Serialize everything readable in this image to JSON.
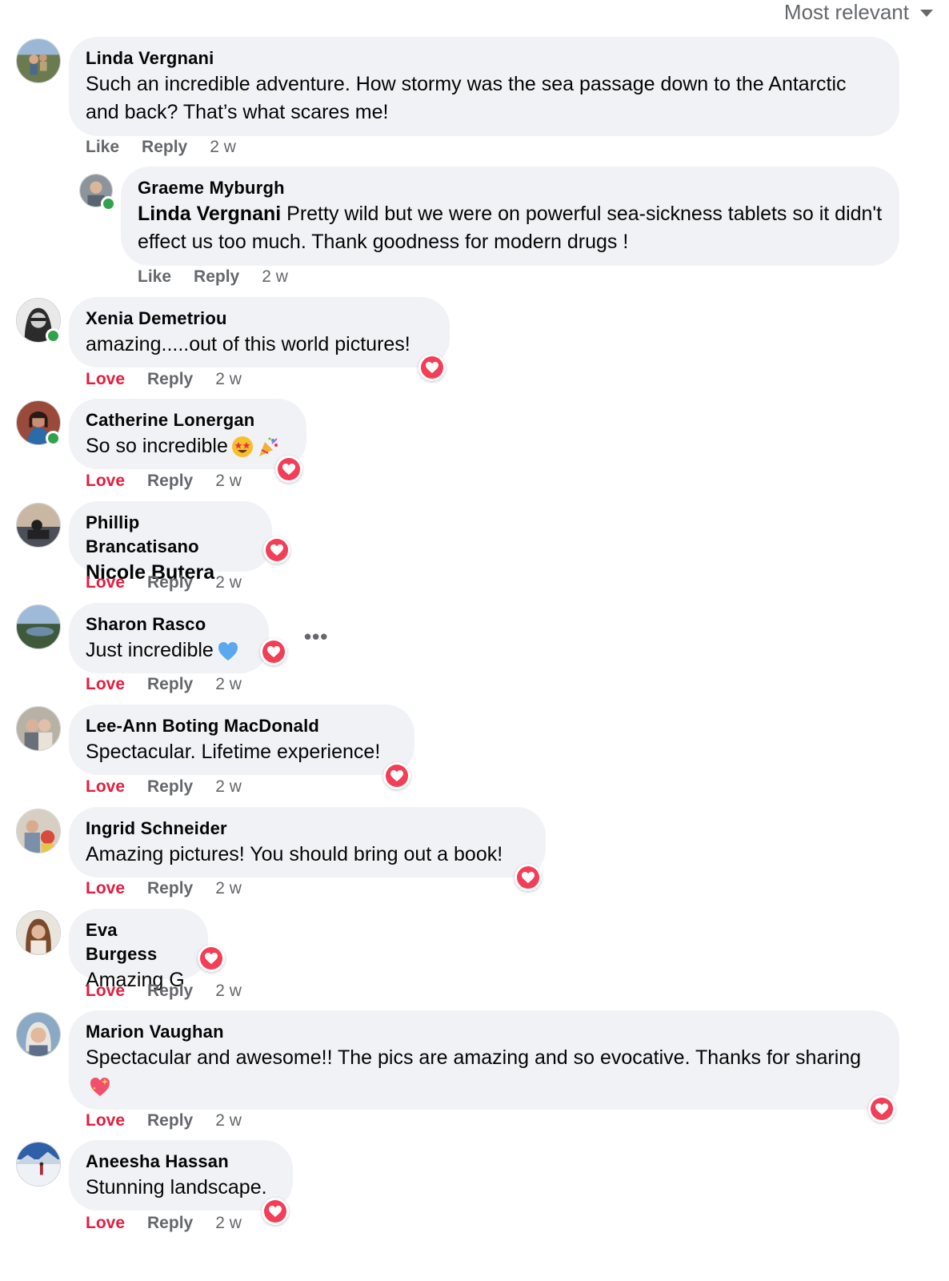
{
  "sort": {
    "label": "Most relevant",
    "icon": "caret-down-icon"
  },
  "actions": {
    "like": "Like",
    "love": "Love",
    "reply": "Reply"
  },
  "comments": [
    {
      "name": "Linda Vergnani",
      "text": "Such an incredible adventure. How stormy was the sea passage down to the Antarctic and back? That’s what scares me!",
      "time": "2 w",
      "reaction": "Like"
    },
    {
      "name": "Graeme Myburgh",
      "mention": "Linda Vergnani",
      "text": " Pretty wild but we were on powerful sea-sickness tablets so it didn't effect us too much. Thank goodness for modern drugs !",
      "time": "2 w",
      "reaction": "Like"
    },
    {
      "name": "Xenia Demetriou",
      "text": "amazing.....out of this world pictures!",
      "time": "2 w",
      "reaction": "Love"
    },
    {
      "name": "Catherine Lonergan",
      "text": "So so incredible",
      "time": "2 w",
      "reaction": "Love",
      "emojis": [
        "star-struck-emoji",
        "party-popper-emoji"
      ]
    },
    {
      "name": "Phillip Brancatisano",
      "mention": "Nicole Butera",
      "text": "",
      "time": "2 w",
      "reaction": "Love"
    },
    {
      "name": "Sharon Rasco",
      "text": "Just incredible",
      "time": "2 w",
      "reaction": "Love",
      "emojis": [
        "blue-heart-emoji"
      ]
    },
    {
      "name": "Lee-Ann Boting MacDonald",
      "text": "Spectacular. Lifetime experience!",
      "time": "2 w",
      "reaction": "Love"
    },
    {
      "name": "Ingrid Schneider",
      "text": "Amazing pictures! You should bring out a book!",
      "time": "2 w",
      "reaction": "Love"
    },
    {
      "name": "Eva Burgess",
      "text": "Amazing G",
      "time": "2 w",
      "reaction": "Love"
    },
    {
      "name": "Marion Vaughan",
      "text": "Spectacular and awesome!! The pics are amazing and so evocative. Thanks for sharing",
      "time": "2 w",
      "reaction": "Love",
      "emojis": [
        "sparkling-heart-emoji"
      ]
    },
    {
      "name": "Aneesha Hassan",
      "text": "Stunning landscape.",
      "time": "2 w",
      "reaction": "Love"
    }
  ],
  "colors": {
    "bubble": "#f0f2f5",
    "love": "#e41e3f",
    "secondary": "#65676b",
    "online": "#31a24c"
  }
}
